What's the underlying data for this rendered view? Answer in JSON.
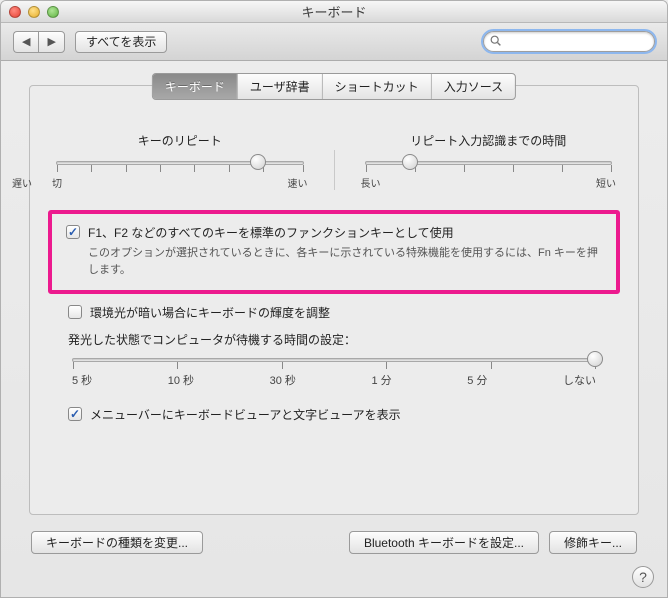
{
  "window": {
    "title": "キーボード"
  },
  "toolbar": {
    "back": "◀",
    "forward": "▶",
    "show_all": "すべてを表示",
    "search_placeholder": ""
  },
  "tabs": [
    {
      "label": "キーボード",
      "active": true
    },
    {
      "label": "ユーザ辞書",
      "active": false
    },
    {
      "label": "ショートカット",
      "active": false
    },
    {
      "label": "入力ソース",
      "active": false
    }
  ],
  "key_repeat": {
    "label": "キーのリピート",
    "min": "切",
    "slow": "遅い",
    "fast": "速い",
    "value": 0.82
  },
  "delay_repeat": {
    "label": "リピート入力認識までの時間",
    "long": "長い",
    "short": "短い",
    "value": 0.18
  },
  "fn_keys": {
    "checked": true,
    "label": "F1、F2 などのすべてのキーを標準のファンクションキーとして使用",
    "desc": "このオプションが選択されているときに、各キーに示されている特殊機能を使用するには、Fn キーを押します。"
  },
  "ambient": {
    "checked": false,
    "label": "環境光が暗い場合にキーボードの輝度を調整"
  },
  "idle": {
    "label": "発光した状態でコンピュータが待機する時間の設定：",
    "ticks": [
      "5 秒",
      "10 秒",
      "30 秒",
      "1 分",
      "5 分",
      "しない"
    ],
    "value": 1.0
  },
  "menubar": {
    "checked": true,
    "label": "メニューバーにキーボードビューアと文字ビューアを表示"
  },
  "buttons": {
    "change_type": "キーボードの種類を変更...",
    "bluetooth": "Bluetooth キーボードを設定...",
    "modifiers": "修飾キー..."
  }
}
